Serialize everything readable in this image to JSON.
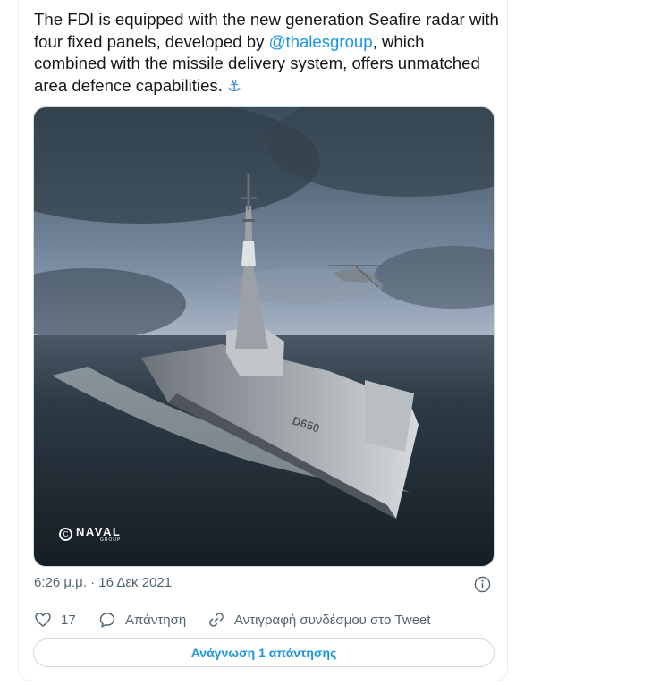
{
  "tweet": {
    "text_part1": "The FDI is equipped with the new generation Seafire radar with four fixed panels, developed by ",
    "mention": "@thalesgroup",
    "text_part2": ", which combined with the missile delivery system, offers unmatched area defence capabilities. ",
    "emoji": "⚓"
  },
  "media": {
    "watermark_icon": "copyright-icon",
    "watermark_brand": "NAVAL",
    "watermark_sub": "GROUP",
    "hull_number": "D650"
  },
  "meta": {
    "timestamp": "6:26 μ.μ. · 16 Δεκ 2021"
  },
  "actions": {
    "like_count": "17",
    "reply_label": "Απάντηση",
    "copy_link_label": "Αντιγραφή συνδέσμου στο Tweet"
  },
  "read_replies_label": "Ανάγνωση 1 απάντησης",
  "colors": {
    "link": "#1b95e0",
    "secondary_text": "#536471",
    "border": "#cfd9de"
  }
}
